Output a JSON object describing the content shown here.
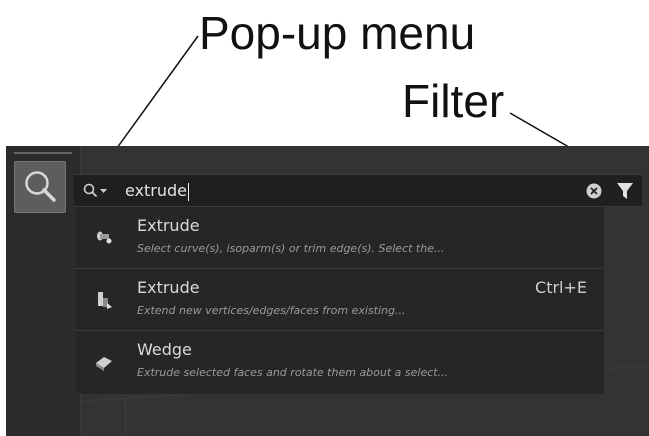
{
  "annotations": {
    "popup_label": "Pop-up menu",
    "filter_label": "Filter"
  },
  "search": {
    "query": "extrude",
    "scope_icon": "magnifier-dropdown-icon",
    "clear_icon": "clear-x-icon",
    "filter_icon": "funnel-filter-icon"
  },
  "results": [
    {
      "title": "Extrude",
      "description": "Select curve(s), isoparm(s) or trim edge(s).  Select the...",
      "shortcut": "",
      "icon": "extrude-curve-icon"
    },
    {
      "title": "Extrude",
      "description": "Extend new vertices/edges/faces from existing...",
      "shortcut": "Ctrl+E",
      "icon": "extrude-polygon-icon"
    },
    {
      "title": "Wedge",
      "description": "Extrude selected faces and rotate them about a select...",
      "shortcut": "",
      "icon": "wedge-icon"
    }
  ],
  "toolbar": {
    "search_tool_icon": "search-icon"
  },
  "colors": {
    "panel_background": "#2f3031",
    "search_bar_background": "#1f1f20",
    "results_background": "#262627",
    "text_primary": "#dadada",
    "text_secondary": "#9a9a9a"
  }
}
